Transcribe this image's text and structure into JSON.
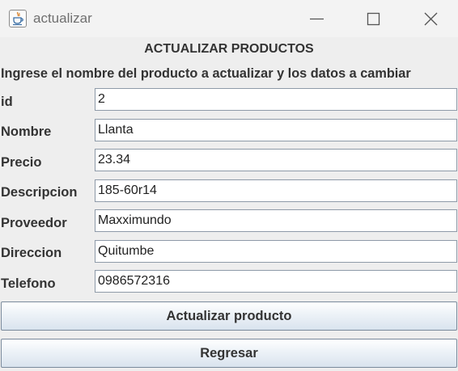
{
  "window": {
    "title": "actualizar"
  },
  "form": {
    "heading": "ACTUALIZAR PRODUCTOS",
    "instructions": "Ingrese el nombre del producto a actualizar y los datos a cambiar",
    "fields": [
      {
        "label": "id",
        "value": "2"
      },
      {
        "label": "Nombre",
        "value": "Llanta"
      },
      {
        "label": "Precio",
        "value": "23.34"
      },
      {
        "label": "Descripcion",
        "value": "185-60r14"
      },
      {
        "label": "Proveedor",
        "value": "Maxximundo"
      },
      {
        "label": "Direccion",
        "value": "Quitumbe"
      },
      {
        "label": "Telefono",
        "value": "0986572316"
      }
    ]
  },
  "buttons": {
    "update_label": "Actualizar producto",
    "back_label": "Regresar"
  },
  "icons": {
    "app": "java-cup-icon",
    "minimize": "minimize-icon",
    "maximize": "maximize-icon",
    "close": "close-icon"
  },
  "colors": {
    "window_background": "#eeeeee",
    "titlebar_background": "#f3f3f3",
    "text": "#333333",
    "input_border": "#8e9aa8",
    "button_gradient_bottom": "#d9e3ee"
  }
}
